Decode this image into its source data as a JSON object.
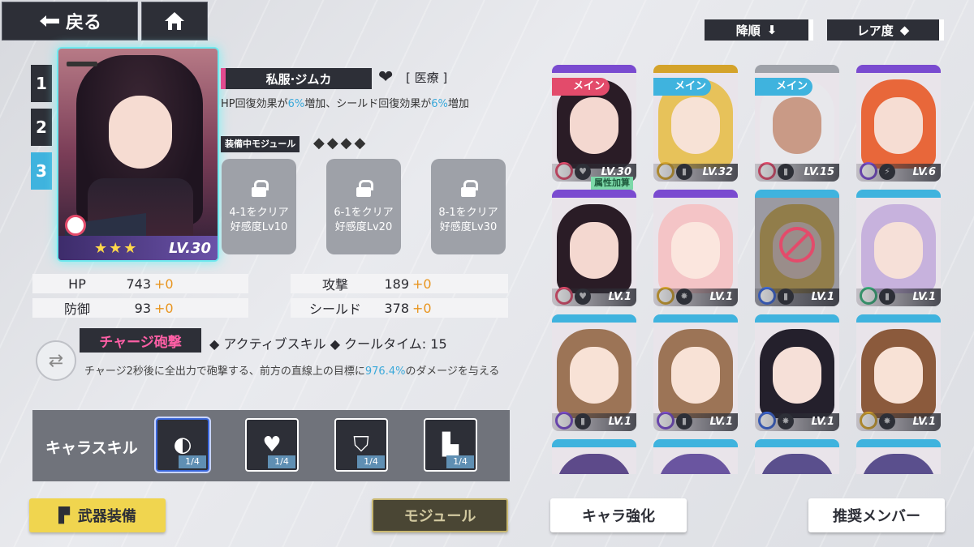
{
  "header": {
    "back_label": "戻る",
    "sort_order_label": "降順",
    "sort_rarity_label": "レア度"
  },
  "team_tabs": [
    "1",
    "2",
    "3"
  ],
  "active_team_tab": "3",
  "character": {
    "name": "私服·ジムカ",
    "role": "[ 医療 ]",
    "level": "LV.30",
    "stars": "★★★",
    "description_parts": [
      "HP回復効果が",
      "6%",
      "増加、シールド回復効果が",
      "6%",
      "増加"
    ],
    "module_label": "装備中モジュール",
    "module_diamonds": "◆◆◆◆",
    "module_slots": [
      {
        "line1": "4-1をクリア",
        "line2": "好感度Lv10"
      },
      {
        "line1": "6-1をクリア",
        "line2": "好感度Lv20"
      },
      {
        "line1": "8-1をクリア",
        "line2": "好感度Lv30"
      }
    ]
  },
  "stats": {
    "hp": {
      "label": "HP",
      "value": "743",
      "bonus": "+0"
    },
    "attack": {
      "label": "攻撃",
      "value": "189",
      "bonus": "+0"
    },
    "defense": {
      "label": "防御",
      "value": "93",
      "bonus": "+0"
    },
    "shield": {
      "label": "シールド",
      "value": "378",
      "bonus": "+0"
    }
  },
  "skill": {
    "name": "チャージ砲撃",
    "meta": "◆ アクティブスキル ◆ クールタイム: 15",
    "desc_parts": [
      "チャージ2秒後に全出力で砲撃する、前方の直線上の目標に",
      "976.4%",
      "のダメージを与える"
    ]
  },
  "chara_skill": {
    "label": "キャラスキル",
    "slots": [
      {
        "level": "1/4",
        "icon": "cannon-icon"
      },
      {
        "level": "1/4",
        "icon": "heart-plus-icon"
      },
      {
        "level": "1/4",
        "icon": "shield-icon"
      },
      {
        "level": "1/4",
        "icon": "boot-icon"
      }
    ]
  },
  "buttons": {
    "weapon": "武器装備",
    "module": "モジュール",
    "enhance": "キャラ強化",
    "recommend": "推奨メンバー"
  },
  "roster": [
    {
      "level": "LV.30",
      "badge": "メイン",
      "frame": "violet"
    },
    {
      "level": "LV.32",
      "badge": "メイン",
      "frame": "gold"
    },
    {
      "level": "LV.15",
      "badge": "メイン",
      "frame": "gray"
    },
    {
      "level": "LV.6",
      "badge": "",
      "frame": "violet"
    },
    {
      "level": "LV.1",
      "badge": "",
      "tag": "属性加算",
      "frame": "violet"
    },
    {
      "level": "LV.1",
      "badge": "",
      "frame": "violet"
    },
    {
      "level": "LV.1",
      "badge": "",
      "frame": "blue"
    },
    {
      "level": "LV.1",
      "badge": "",
      "frame": "blue"
    },
    {
      "level": "LV.1",
      "badge": "",
      "frame": "blue"
    },
    {
      "level": "LV.1",
      "badge": "",
      "frame": "blue"
    },
    {
      "level": "LV.1",
      "badge": "",
      "frame": "blue"
    },
    {
      "level": "LV.1",
      "badge": "",
      "frame": "blue"
    }
  ]
}
